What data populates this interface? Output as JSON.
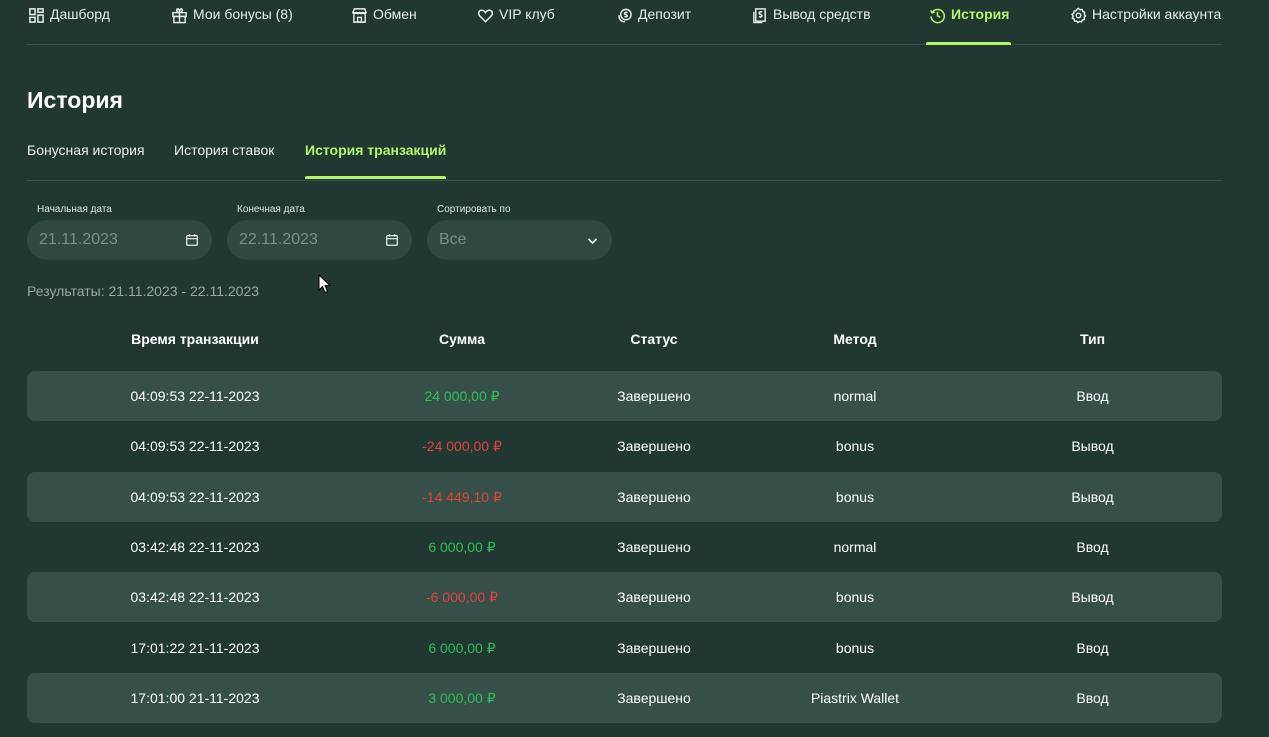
{
  "nav": {
    "items": [
      {
        "label": "Дашборд",
        "icon": "dashboard-icon"
      },
      {
        "label": "Мои бонусы (8)",
        "icon": "gift-icon"
      },
      {
        "label": "Обмен",
        "icon": "store-icon"
      },
      {
        "label": "VIP клуб",
        "icon": "heart-icon"
      },
      {
        "label": "Депозит",
        "icon": "coins-icon"
      },
      {
        "label": "Вывод средств",
        "icon": "withdraw-icon"
      },
      {
        "label": "История",
        "icon": "clock-icon",
        "active": true
      },
      {
        "label": "Настройки аккаунта",
        "icon": "gear-icon"
      }
    ]
  },
  "page": {
    "title": "История"
  },
  "tabs": [
    {
      "label": "Бонусная история"
    },
    {
      "label": "История ставок"
    },
    {
      "label": "История транзакций",
      "active": true
    }
  ],
  "filters": {
    "start_label": "Начальная дата",
    "start_value": "21.11.2023",
    "end_label": "Конечная дата",
    "end_value": "22.11.2023",
    "sort_label": "Сортировать по",
    "sort_value": "Все"
  },
  "results_text": "Результаты: 21.11.2023 - 22.11.2023",
  "table": {
    "headers": [
      "Время транзакции",
      "Сумма",
      "Статус",
      "Метод",
      "Тип"
    ],
    "rows": [
      {
        "time": "04:09:53 22-11-2023",
        "amount": "24 000,00 ₽",
        "sign": "pos",
        "status": "Завершено",
        "method": "normal",
        "type": "Ввод"
      },
      {
        "time": "04:09:53 22-11-2023",
        "amount": "-24 000,00 ₽",
        "sign": "neg",
        "status": "Завершено",
        "method": "bonus",
        "type": "Вывод"
      },
      {
        "time": "04:09:53 22-11-2023",
        "amount": "-14 449,10 ₽",
        "sign": "neg",
        "status": "Завершено",
        "method": "bonus",
        "type": "Вывод"
      },
      {
        "time": "03:42:48 22-11-2023",
        "amount": "6 000,00 ₽",
        "sign": "pos",
        "status": "Завершено",
        "method": "normal",
        "type": "Ввод"
      },
      {
        "time": "03:42:48 22-11-2023",
        "amount": "-6 000,00 ₽",
        "sign": "neg",
        "status": "Завершено",
        "method": "bonus",
        "type": "Вывод"
      },
      {
        "time": "17:01:22 21-11-2023",
        "amount": "6 000,00 ₽",
        "sign": "pos",
        "status": "Завершено",
        "method": "bonus",
        "type": "Ввод"
      },
      {
        "time": "17:01:00 21-11-2023",
        "amount": "3 000,00 ₽",
        "sign": "pos",
        "status": "Завершено",
        "method": "Piastrix Wallet",
        "type": "Ввод"
      }
    ]
  },
  "colors": {
    "background": "#213832",
    "accent": "#b4f56a",
    "row_stripe": "#365049",
    "positive": "#2fbf53",
    "negative": "#e0433c"
  }
}
